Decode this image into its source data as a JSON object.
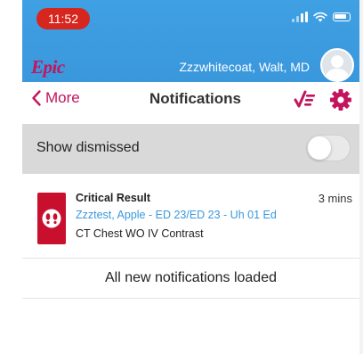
{
  "status_bar": {
    "time": "11:52"
  },
  "header": {
    "logo": "Epic",
    "user_name": "Zzzwhitecoat, Walt, MD"
  },
  "navbar": {
    "back_label": "More",
    "title": "Notifications"
  },
  "dismissed": {
    "label": "Show dismissed",
    "enabled": false
  },
  "notifications": [
    {
      "title": "Critical Result",
      "time": "3 mins",
      "patient": "Zzztest, Apple - ED 23/ED 23 - Uh 01 Ed",
      "detail": "CT Chest WO IV Contrast",
      "icon": "alert-footprints-icon"
    }
  ],
  "footer": {
    "loaded_text": "All new notifications loaded"
  },
  "colors": {
    "header_blue": "#3a97dc",
    "accent_magenta": "#c2155d",
    "time_pill_red": "#d7261e",
    "alert_red": "#c8102e",
    "dismissed_bg": "#d9d9d9"
  }
}
